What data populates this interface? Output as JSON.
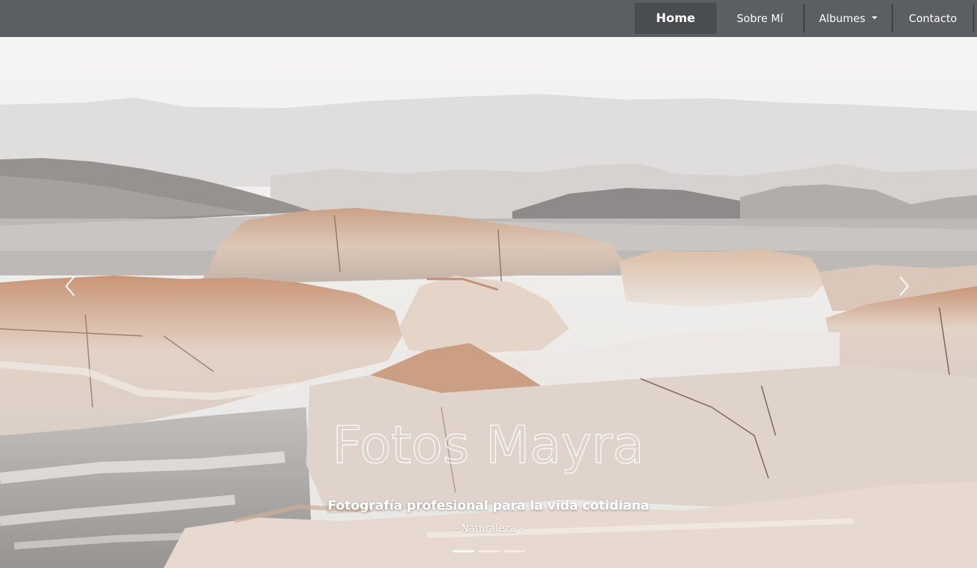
{
  "navbar": {
    "items": [
      {
        "label": "Home",
        "active": true
      },
      {
        "label": "Sobre Mí",
        "active": false
      },
      {
        "label": "Albumes",
        "active": false,
        "dropdown": true
      },
      {
        "label": "Contacto",
        "active": false
      }
    ]
  },
  "hero": {
    "title": "Fotos Mayra",
    "subtitle": "Fotografía profesional para la vida cotidiana",
    "category": "- Naturaleza -",
    "slide_count": 3,
    "active_slide": 1
  },
  "colors": {
    "navbar_bg": "#5c5f62",
    "active_item_bg": "#4a4d50",
    "text": "#ffffff"
  },
  "icons": {
    "prev": "chevron-left-icon",
    "next": "chevron-right-icon",
    "dropdown": "caret-down-icon"
  }
}
